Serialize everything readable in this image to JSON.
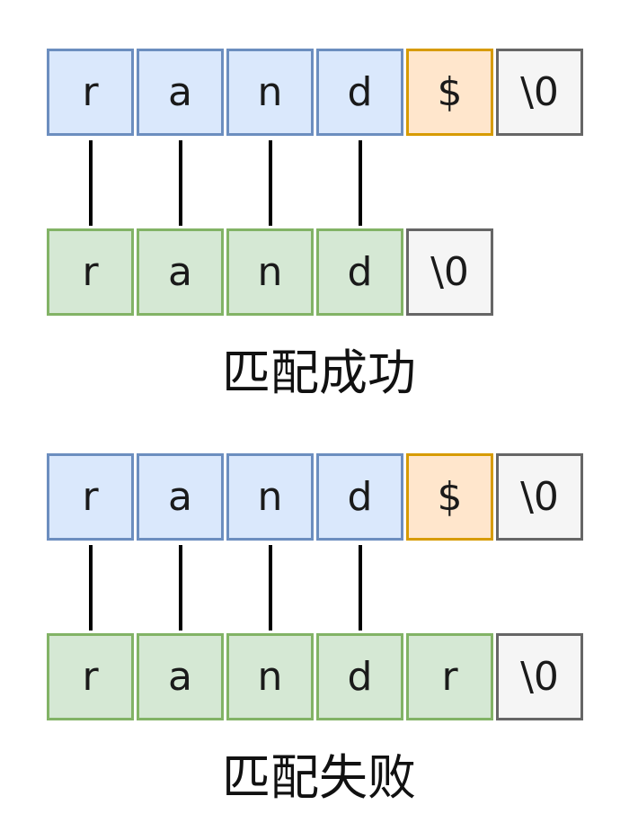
{
  "examples": [
    {
      "top_row": [
        {
          "char": "r",
          "style": "blue"
        },
        {
          "char": "a",
          "style": "blue"
        },
        {
          "char": "n",
          "style": "blue"
        },
        {
          "char": "d",
          "style": "blue"
        },
        {
          "char": "$",
          "style": "orange"
        },
        {
          "char": "\\0",
          "style": "gray"
        }
      ],
      "bottom_row": [
        {
          "char": "r",
          "style": "green"
        },
        {
          "char": "a",
          "style": "green"
        },
        {
          "char": "n",
          "style": "green"
        },
        {
          "char": "d",
          "style": "green"
        },
        {
          "char": "\\0",
          "style": "gray"
        }
      ],
      "caption": "匹配成功"
    },
    {
      "top_row": [
        {
          "char": "r",
          "style": "blue"
        },
        {
          "char": "a",
          "style": "blue"
        },
        {
          "char": "n",
          "style": "blue"
        },
        {
          "char": "d",
          "style": "blue"
        },
        {
          "char": "$",
          "style": "orange"
        },
        {
          "char": "\\0",
          "style": "gray"
        }
      ],
      "bottom_row": [
        {
          "char": "r",
          "style": "green"
        },
        {
          "char": "a",
          "style": "green"
        },
        {
          "char": "n",
          "style": "green"
        },
        {
          "char": "d",
          "style": "green"
        },
        {
          "char": "r",
          "style": "green"
        },
        {
          "char": "\\0",
          "style": "gray"
        }
      ],
      "caption": "匹配失败"
    }
  ],
  "colors": {
    "blue_fill": "#dae8fc",
    "blue_border": "#6c8ebf",
    "orange_fill": "#ffe6cc",
    "orange_border": "#d79b00",
    "gray_fill": "#f5f5f5",
    "gray_border": "#666666",
    "green_fill": "#d5e8d4",
    "green_border": "#82b366"
  }
}
